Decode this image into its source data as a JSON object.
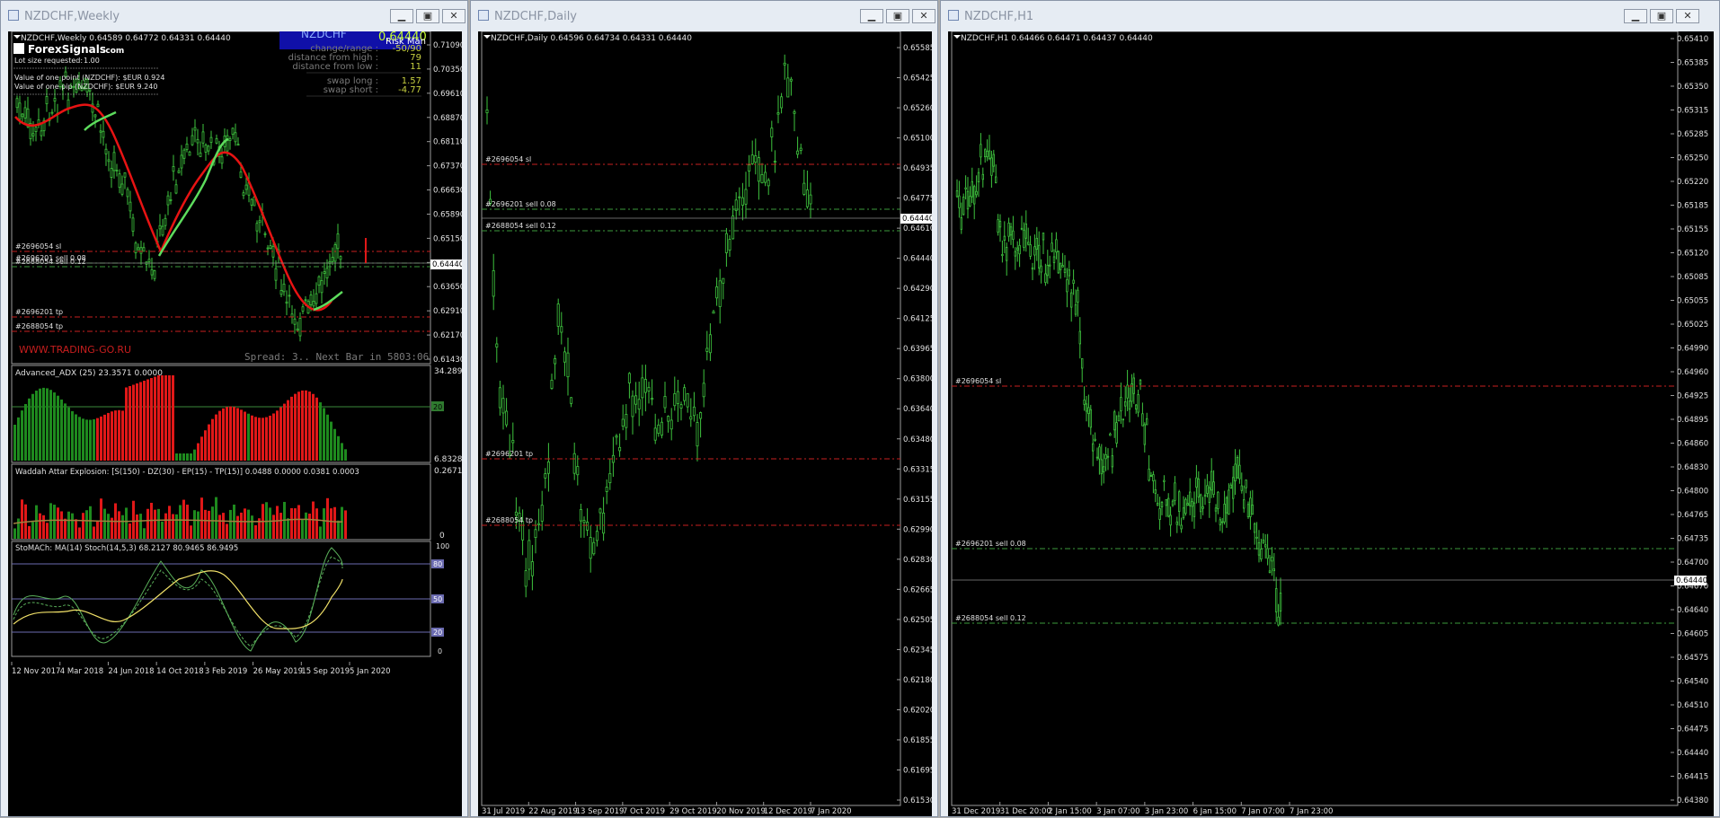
{
  "windows": [
    {
      "title": "NZDCHF,Weekly"
    },
    {
      "title": "NZDCHF,Daily"
    },
    {
      "title": "NZDCHF,H1"
    }
  ],
  "colors": {
    "bull": "#3ec43e",
    "bear": "#e01818",
    "ma_red": "#e81313",
    "ma_green": "#5ddc5d",
    "level_red": "#c82020",
    "level_green": "#3c9a3c",
    "info_blue": "#1010a8",
    "text": "#e0e0e0",
    "price_tag": "#ffffff"
  },
  "weekly": {
    "header": "NZDCHF,Weekly  0.64589 0.64772 0.64331 0.64440",
    "brand": "ForexSignals",
    "brand_suffix": ".com",
    "lot_label": "Lot size requested:",
    "lot_value": "1.00",
    "value_point": "Value of one point (NZDCHF):  $EUR 0.924",
    "value_pip": "Value of one pip    (NZDCHF):  $EUR 9.240",
    "info_symbol": "NZDCHF",
    "info_price": "0.64440",
    "info_risk": "Risk Man",
    "info_rows": [
      {
        "label": "change/range :",
        "value": "-50/90"
      },
      {
        "label": "distance from high :",
        "value": "79"
      },
      {
        "label": "distance from low :",
        "value": "11"
      },
      {
        "label": "swap long :",
        "value": "1.57"
      },
      {
        "label": "swap short :",
        "value": "-4.77"
      }
    ],
    "watermark": "WWW.TRADING-GO.RU",
    "spread": "Spread: 3.. Next Bar in 5803:06",
    "levels": [
      {
        "label": "#2696054 sl",
        "kind": "sl"
      },
      {
        "label": "#2696201 sell 0.08",
        "kind": "sell"
      },
      {
        "label": "#2688054 sell 0.12",
        "kind": "sell"
      },
      {
        "label": "#2696201 tp",
        "kind": "tp"
      },
      {
        "label": "#2688054 tp",
        "kind": "tp"
      }
    ],
    "price_axis": [
      "0.71090",
      "0.70350",
      "0.69610",
      "0.68870",
      "0.68110",
      "0.67370",
      "0.66630",
      "0.65890",
      "0.65150",
      "0.64440",
      "0.63650",
      "0.62910",
      "0.62170",
      "0.61430"
    ],
    "current_price": "0.64440",
    "time_axis": [
      "12 Nov 2017",
      "4 Mar 2018",
      "24 Jun 2018",
      "14 Oct 2018",
      "3 Feb 2019",
      "26 May 2019",
      "15 Sep 2019",
      "5 Jan 2020"
    ],
    "adx": {
      "label": "Advanced_ADX (25) 23.3571 0.0000",
      "top": "34.2892",
      "level": "20",
      "bottom": "6.8328"
    },
    "waddah": {
      "label": "Waddah Attar Explosion: [S(150) - DZ(30) - EP(15) - TP(15)] 0.0488 0.0000 0.0381 0.0003",
      "top": "0.2671",
      "bottom": "0"
    },
    "stoch": {
      "label": "StoMACh: MA(14)  Stoch(14,5,3) 68.2127 80.9465 86.9495",
      "levels": [
        "100",
        "80",
        "50",
        "20",
        "0"
      ]
    }
  },
  "daily": {
    "header": "NZDCHF,Daily  0.64596 0.64734 0.64331 0.64440",
    "levels": [
      {
        "label": "#2696054 sl"
      },
      {
        "label": "#2696201 sell 0.08"
      },
      {
        "label": "#2688054 sell 0.12"
      },
      {
        "label": "#2696201 tp"
      },
      {
        "label": "#2688054 tp"
      }
    ],
    "price_axis": [
      "0.65585",
      "0.65425",
      "0.65260",
      "0.65100",
      "0.64935",
      "0.64775",
      "0.64610",
      "0.64440",
      "0.64290",
      "0.64125",
      "0.63965",
      "0.63800",
      "0.63640",
      "0.63480",
      "0.63315",
      "0.63155",
      "0.62990",
      "0.62830",
      "0.62665",
      "0.62505",
      "0.62345",
      "0.62180",
      "0.62020",
      "0.61855",
      "0.61695",
      "0.61530"
    ],
    "current_price": "0.64440",
    "time_axis": [
      "31 Jul 2019",
      "22 Aug 2019",
      "13 Sep 2019",
      "7 Oct 2019",
      "29 Oct 2019",
      "20 Nov 2019",
      "12 Dec 2019",
      "7 Jan 2020"
    ]
  },
  "h1": {
    "header": "NZDCHF,H1  0.64466 0.64471 0.64437 0.64440",
    "levels": [
      {
        "label": "#2696054 sl"
      },
      {
        "label": "#2696201 sell 0.08"
      },
      {
        "label": "#2688054 sell 0.12"
      }
    ],
    "price_axis": [
      "0.65410",
      "0.65385",
      "0.65350",
      "0.65315",
      "0.65285",
      "0.65250",
      "0.65220",
      "0.65185",
      "0.65155",
      "0.65120",
      "0.65085",
      "0.65055",
      "0.65025",
      "0.64990",
      "0.64960",
      "0.64925",
      "0.64895",
      "0.64860",
      "0.64830",
      "0.64800",
      "0.64765",
      "0.64735",
      "0.64700",
      "0.64670",
      "0.64640",
      "0.64605",
      "0.64575",
      "0.64540",
      "0.64510",
      "0.64475",
      "0.64440",
      "0.64415",
      "0.64380"
    ],
    "current_price": "0.64440",
    "time_axis": [
      "31 Dec 2019",
      "31 Dec 20:00",
      "2 Jan 15:00",
      "3 Jan 07:00",
      "3 Jan 23:00",
      "6 Jan 15:00",
      "7 Jan 07:00",
      "7 Jan 23:00"
    ]
  }
}
